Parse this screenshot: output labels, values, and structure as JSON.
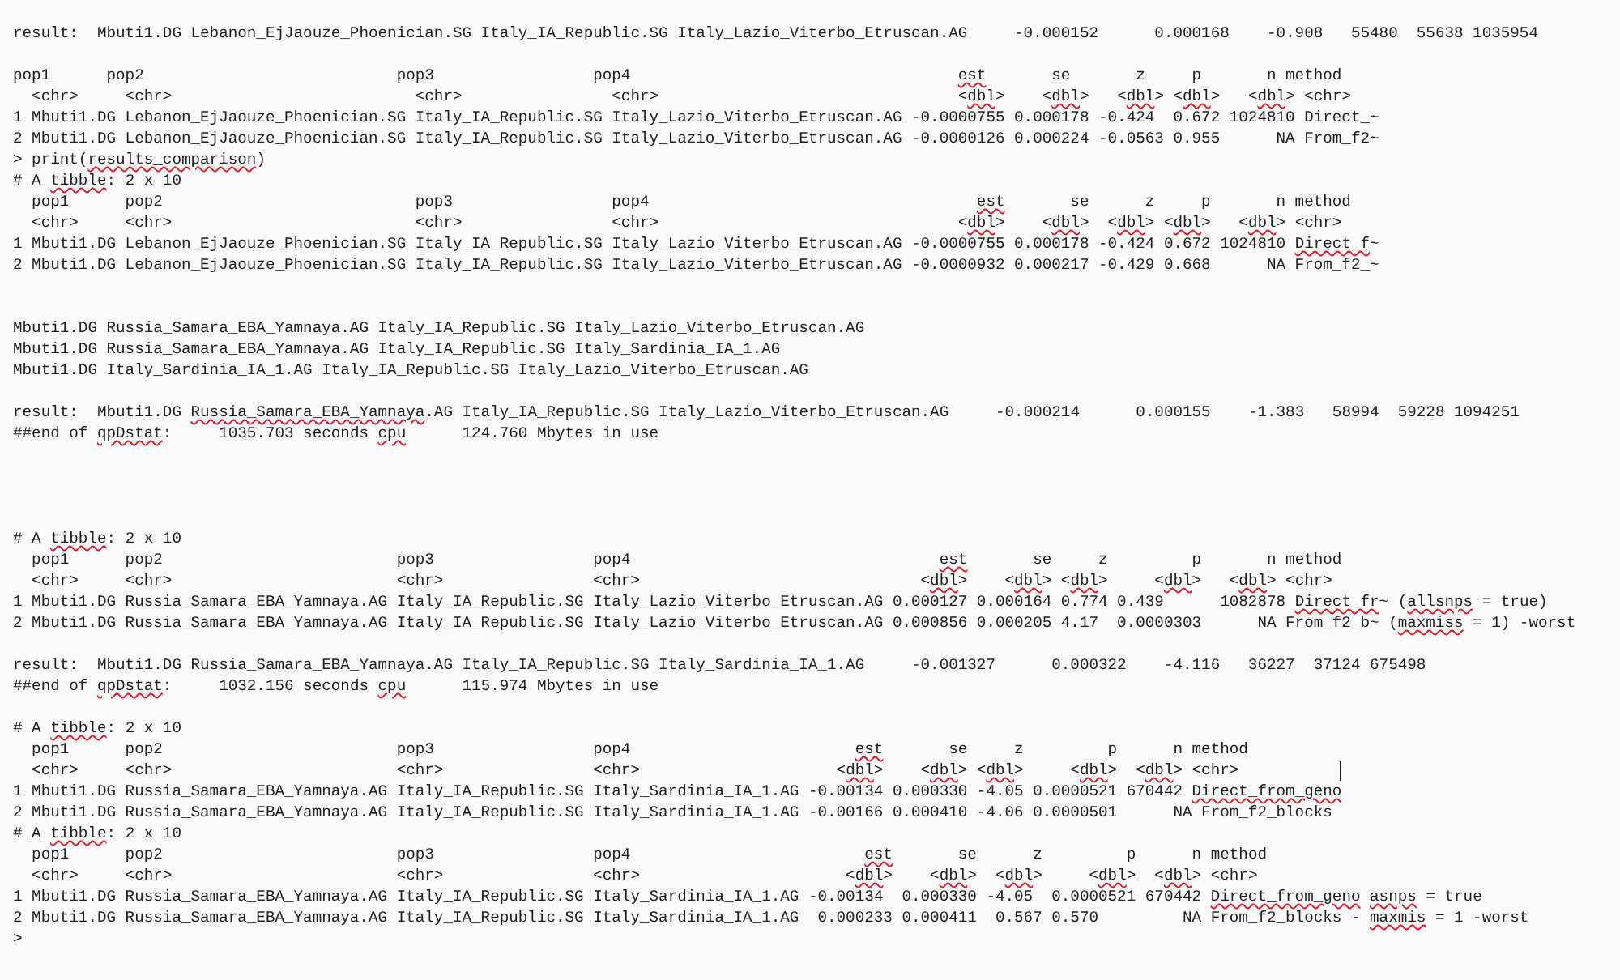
{
  "document": {
    "blocks": [
      {
        "lines": [
          {
            "segments": [
              {
                "text": "result:  Mbuti1.DG Lebanon_EjJaouze_Phoenician.SG Italy_IA_Republic.SG Italy_Lazio_Viterbo_Etruscan.AG     -0.000152      0.000168    -0.908   55480  55638 1035954",
                "misspelled": false
              }
            ]
          }
        ]
      },
      {
        "lines": [
          {
            "segments": [
              {
                "text": "pop1      pop2                           pop3                 pop4                                   ",
                "misspelled": false
              },
              {
                "text": "est",
                "misspelled": true
              },
              {
                "text": "       se       z     p       n method",
                "misspelled": false
              }
            ]
          },
          {
            "segments": [
              {
                "text": "  <chr>     <chr>                          <chr>                <chr>                                <",
                "misspelled": false
              },
              {
                "text": "dbl",
                "misspelled": true
              },
              {
                "text": ">    <",
                "misspelled": false
              },
              {
                "text": "dbl",
                "misspelled": true
              },
              {
                "text": ">   <",
                "misspelled": false
              },
              {
                "text": "dbl",
                "misspelled": true
              },
              {
                "text": "> <",
                "misspelled": false
              },
              {
                "text": "dbl",
                "misspelled": true
              },
              {
                "text": ">   <",
                "misspelled": false
              },
              {
                "text": "dbl",
                "misspelled": true
              },
              {
                "text": "> <chr>",
                "misspelled": false
              }
            ]
          },
          {
            "segments": [
              {
                "text": "1 Mbuti1.DG Lebanon_EjJaouze_Phoenician.SG Italy_IA_Republic.SG Italy_Lazio_Viterbo_Etruscan.AG -0.0000755 0.000178 -0.424  0.672 1024810 Direct_~",
                "misspelled": false
              }
            ]
          },
          {
            "segments": [
              {
                "text": "2 Mbuti1.DG Lebanon_EjJaouze_Phoenician.SG Italy_IA_Republic.SG Italy_Lazio_Viterbo_Etruscan.AG -0.0000126 0.000224 -0.0563 0.955      NA From_f2~",
                "misspelled": false
              }
            ]
          },
          {
            "segments": [
              {
                "text": "> print(",
                "misspelled": false
              },
              {
                "text": "results_comparison",
                "misspelled": true
              },
              {
                "text": ")",
                "misspelled": false
              }
            ]
          },
          {
            "segments": [
              {
                "text": "# A ",
                "misspelled": false
              },
              {
                "text": "tibble",
                "misspelled": true
              },
              {
                "text": ": 2 x 10",
                "misspelled": false
              }
            ]
          },
          {
            "segments": [
              {
                "text": "  pop1      pop2                           pop3                 pop4                                   ",
                "misspelled": false
              },
              {
                "text": "est",
                "misspelled": true
              },
              {
                "text": "       se      z     p       n method",
                "misspelled": false
              }
            ]
          },
          {
            "segments": [
              {
                "text": "  <chr>     <chr>                          <chr>                <chr>                                <",
                "misspelled": false
              },
              {
                "text": "dbl",
                "misspelled": true
              },
              {
                "text": ">    <",
                "misspelled": false
              },
              {
                "text": "dbl",
                "misspelled": true
              },
              {
                "text": ">  <",
                "misspelled": false
              },
              {
                "text": "dbl",
                "misspelled": true
              },
              {
                "text": "> <",
                "misspelled": false
              },
              {
                "text": "dbl",
                "misspelled": true
              },
              {
                "text": ">   <",
                "misspelled": false
              },
              {
                "text": "dbl",
                "misspelled": true
              },
              {
                "text": "> <chr>",
                "misspelled": false
              }
            ]
          },
          {
            "segments": [
              {
                "text": "1 Mbuti1.DG Lebanon_EjJaouze_Phoenician.SG Italy_IA_Republic.SG Italy_Lazio_Viterbo_Etruscan.AG -0.0000755 0.000178 -0.424 0.672 1024810 ",
                "misspelled": false
              },
              {
                "text": "Direct_f",
                "misspelled": true
              },
              {
                "text": "~",
                "misspelled": false
              }
            ]
          },
          {
            "segments": [
              {
                "text": "2 Mbuti1.DG Lebanon_EjJaouze_Phoenician.SG Italy_IA_Republic.SG Italy_Lazio_Viterbo_Etruscan.AG -0.0000932 0.000217 -0.429 0.668      NA From_f2_~",
                "misspelled": false
              }
            ]
          }
        ]
      },
      {
        "lines": [
          {
            "segments": [
              {
                "text": "Mbuti1.DG Russia_Samara_EBA_Yamnaya.AG Italy_IA_Republic.SG Italy_Lazio_Viterbo_Etruscan.AG",
                "misspelled": false
              }
            ]
          },
          {
            "segments": [
              {
                "text": "Mbuti1.DG Russia_Samara_EBA_Yamnaya.AG Italy_IA_Republic.SG Italy_Sardinia_IA_1.AG",
                "misspelled": false
              }
            ]
          },
          {
            "segments": [
              {
                "text": "Mbuti1.DG Italy_Sardinia_IA_1.AG Italy_IA_Republic.SG Italy_Lazio_Viterbo_Etruscan.AG",
                "misspelled": false
              }
            ]
          }
        ]
      },
      {
        "lines": [
          {
            "segments": [
              {
                "text": "result:  Mbuti1.DG ",
                "misspelled": false
              },
              {
                "text": "Russia_Samara_EBA_Yamnaya",
                "misspelled": true
              },
              {
                "text": ".AG Italy_IA_Republic.SG Italy_Lazio_Viterbo_Etruscan.AG     -0.000214      0.000155    -1.383   58994  59228 1094251",
                "misspelled": false
              }
            ]
          },
          {
            "segments": [
              {
                "text": "##end of ",
                "misspelled": false
              },
              {
                "text": "qpDstat",
                "misspelled": true
              },
              {
                "text": ":     1035.703 seconds ",
                "misspelled": false
              },
              {
                "text": "cpu",
                "misspelled": true
              },
              {
                "text": "      124.760 Mbytes in use",
                "misspelled": false
              }
            ]
          }
        ]
      },
      {
        "lines": [
          {
            "segments": [
              {
                "text": "# A ",
                "misspelled": false
              },
              {
                "text": "tibble",
                "misspelled": true
              },
              {
                "text": ": 2 x 10",
                "misspelled": false
              }
            ]
          },
          {
            "segments": [
              {
                "text": "  pop1      pop2                         pop3                 pop4                                 ",
                "misspelled": false
              },
              {
                "text": "est",
                "misspelled": true
              },
              {
                "text": "       se     z         p       n method",
                "misspelled": false
              }
            ]
          },
          {
            "segments": [
              {
                "text": "  <chr>     <chr>                        <chr>                <chr>                              <",
                "misspelled": false
              },
              {
                "text": "dbl",
                "misspelled": true
              },
              {
                "text": ">    <",
                "misspelled": false
              },
              {
                "text": "dbl",
                "misspelled": true
              },
              {
                "text": "> <",
                "misspelled": false
              },
              {
                "text": "dbl",
                "misspelled": true
              },
              {
                "text": ">     <",
                "misspelled": false
              },
              {
                "text": "dbl",
                "misspelled": true
              },
              {
                "text": ">   <",
                "misspelled": false
              },
              {
                "text": "dbl",
                "misspelled": true
              },
              {
                "text": "> <chr>",
                "misspelled": false
              }
            ]
          },
          {
            "segments": [
              {
                "text": "1 Mbuti1.DG Russia_Samara_EBA_Yamnaya.AG Italy_IA_Republic.SG Italy_Lazio_Viterbo_Etruscan.AG 0.000127 0.000164 0.774 0.439      1082878 ",
                "misspelled": false
              },
              {
                "text": "Direct_fr",
                "misspelled": true
              },
              {
                "text": "~ (",
                "misspelled": false
              },
              {
                "text": "allsnps",
                "misspelled": true
              },
              {
                "text": " = true)",
                "misspelled": false
              }
            ]
          },
          {
            "segments": [
              {
                "text": "2 Mbuti1.DG Russia_Samara_EBA_Yamnaya.AG Italy_IA_Republic.SG Italy_Lazio_Viterbo_Etruscan.AG 0.000856 0.000205 4.17  0.0000303      NA From_f2_b~ (",
                "misspelled": false
              },
              {
                "text": "maxmiss",
                "misspelled": true
              },
              {
                "text": " = 1) -worst",
                "misspelled": false
              }
            ]
          }
        ]
      },
      {
        "lines": [
          {
            "segments": [
              {
                "text": "result:  Mbuti1.DG Russia_Samara_EBA_Yamnaya.AG Italy_IA_Republic.SG Italy_Sardinia_IA_1.AG     -0.001327      0.000322    -4.116   36227  37124 675498",
                "misspelled": false
              }
            ]
          },
          {
            "segments": [
              {
                "text": "##end of ",
                "misspelled": false
              },
              {
                "text": "qpDstat",
                "misspelled": true
              },
              {
                "text": ":     1032.156 seconds ",
                "misspelled": false
              },
              {
                "text": "cpu",
                "misspelled": true
              },
              {
                "text": "      115.974 Mbytes in use",
                "misspelled": false
              }
            ]
          }
        ]
      },
      {
        "lines": [
          {
            "segments": [
              {
                "text": "# A ",
                "misspelled": false
              },
              {
                "text": "tibble",
                "misspelled": true
              },
              {
                "text": ": 2 x 10",
                "misspelled": false
              }
            ]
          },
          {
            "segments": [
              {
                "text": "  pop1      pop2                         pop3                 pop4                        ",
                "misspelled": false
              },
              {
                "text": "est",
                "misspelled": true
              },
              {
                "text": "       se     z         p      n method",
                "misspelled": false
              }
            ]
          },
          {
            "text_cursor": true,
            "segments": [
              {
                "text": "  <chr>     <chr>                        <chr>                <chr>                     <",
                "misspelled": false
              },
              {
                "text": "dbl",
                "misspelled": true
              },
              {
                "text": ">    <",
                "misspelled": false
              },
              {
                "text": "dbl",
                "misspelled": true
              },
              {
                "text": "> <",
                "misspelled": false
              },
              {
                "text": "dbl",
                "misspelled": true
              },
              {
                "text": ">     <",
                "misspelled": false
              },
              {
                "text": "dbl",
                "misspelled": true
              },
              {
                "text": ">  <",
                "misspelled": false
              },
              {
                "text": "dbl",
                "misspelled": true
              },
              {
                "text": "> <chr>",
                "misspelled": false
              }
            ]
          },
          {
            "segments": [
              {
                "text": "1 Mbuti1.DG Russia_Samara_EBA_Yamnaya.AG Italy_IA_Republic.SG Italy_Sardinia_IA_1.AG -0.00134 0.000330 -4.05 0.0000521 670442 ",
                "misspelled": false
              },
              {
                "text": "Direct_from_geno",
                "misspelled": true
              }
            ]
          },
          {
            "segments": [
              {
                "text": "2 Mbuti1.DG Russia_Samara_EBA_Yamnaya.AG Italy_IA_Republic.SG Italy_Sardinia_IA_1.AG -0.00166 0.000410 -4.06 0.0000501      NA From_f2_blocks",
                "misspelled": false
              }
            ]
          },
          {
            "segments": [
              {
                "text": "# A ",
                "misspelled": false
              },
              {
                "text": "tibble",
                "misspelled": true
              },
              {
                "text": ": 2 x 10",
                "misspelled": false
              }
            ]
          },
          {
            "segments": [
              {
                "text": "  pop1      pop2                         pop3                 pop4                         ",
                "misspelled": false
              },
              {
                "text": "est",
                "misspelled": true
              },
              {
                "text": "       se      z         p      n method",
                "misspelled": false
              }
            ]
          },
          {
            "segments": [
              {
                "text": "  <chr>     <chr>                        <chr>                <chr>                      <",
                "misspelled": false
              },
              {
                "text": "dbl",
                "misspelled": true
              },
              {
                "text": ">    <",
                "misspelled": false
              },
              {
                "text": "dbl",
                "misspelled": true
              },
              {
                "text": ">  <",
                "misspelled": false
              },
              {
                "text": "dbl",
                "misspelled": true
              },
              {
                "text": ">     <",
                "misspelled": false
              },
              {
                "text": "dbl",
                "misspelled": true
              },
              {
                "text": ">  <",
                "misspelled": false
              },
              {
                "text": "dbl",
                "misspelled": true
              },
              {
                "text": "> <chr>",
                "misspelled": false
              }
            ]
          },
          {
            "segments": [
              {
                "text": "1 Mbuti1.DG Russia_Samara_EBA_Yamnaya.AG Italy_IA_Republic.SG Italy_Sardinia_IA_1.AG -0.00134  0.000330 -4.05  0.0000521 670442 ",
                "misspelled": false
              },
              {
                "text": "Direct_from_geno ",
                "misspelled": true
              },
              {
                "text": "asnps",
                "misspelled": true
              },
              {
                "text": " = true",
                "misspelled": false
              }
            ]
          },
          {
            "segments": [
              {
                "text": "2 Mbuti1.DG Russia_Samara_EBA_Yamnaya.AG Italy_IA_Republic.SG Italy_Sardinia_IA_1.AG  0.000233 0.000411  0.567 0.570         NA From_f2_blocks - ",
                "misspelled": false
              },
              {
                "text": "maxmis",
                "misspelled": true
              },
              {
                "text": " = 1 -worst",
                "misspelled": false
              }
            ]
          },
          {
            "segments": [
              {
                "text": ">",
                "misspelled": false
              }
            ]
          }
        ]
      }
    ]
  }
}
